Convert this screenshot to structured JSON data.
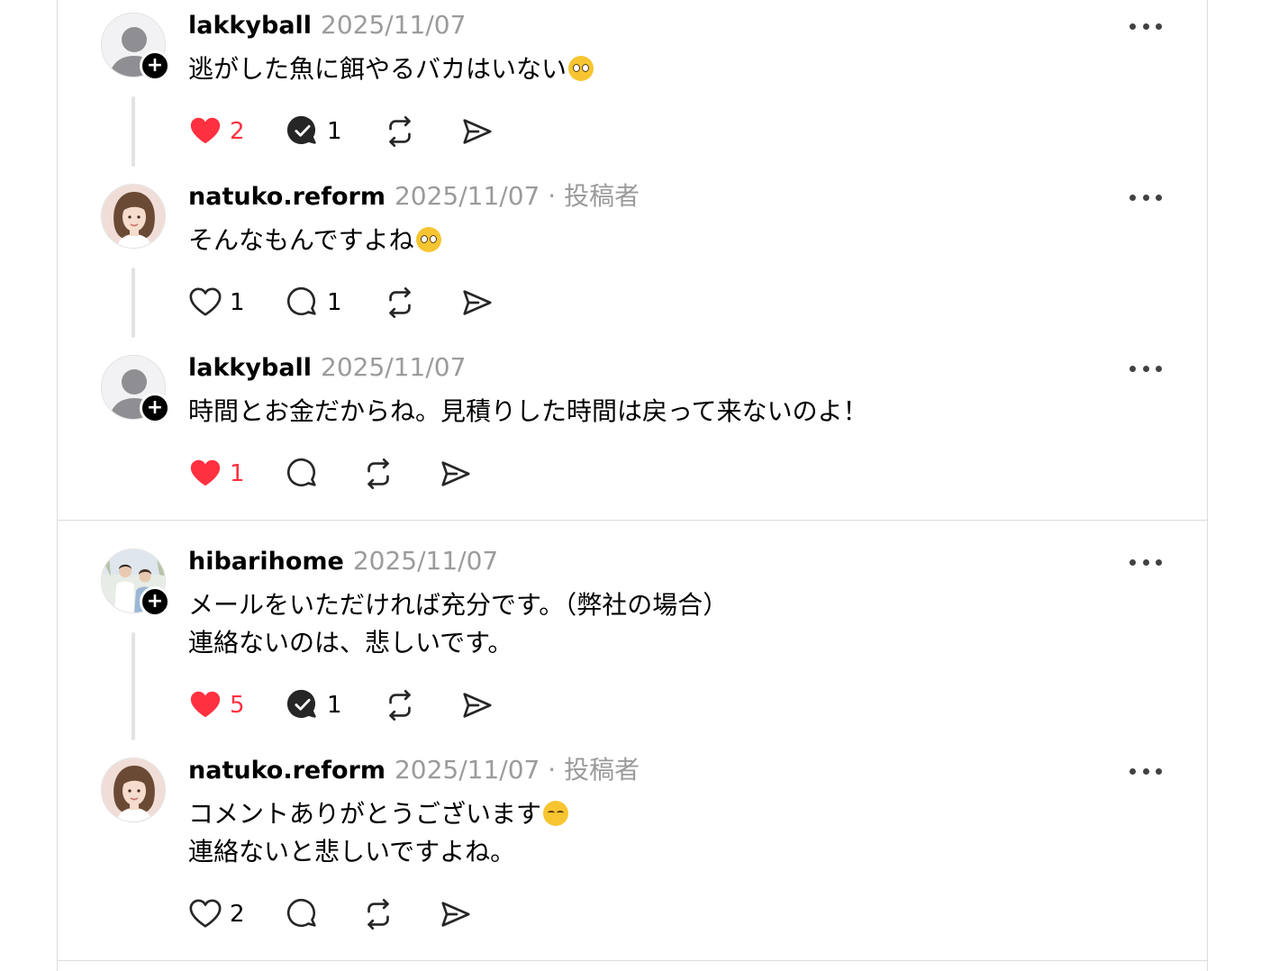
{
  "theme": {
    "like_red": "#ff3040",
    "muted": "#9b9b9b",
    "border": "#dcdcdc"
  },
  "icons": {
    "like": "heart-icon",
    "reply": "comment-bubble-icon",
    "reposted": "check-bubble-icon",
    "repost": "repost-icon",
    "share": "send-icon",
    "more": "more-dots-icon",
    "follow": "plus-icon"
  },
  "follow_label": "+",
  "posts": [
    {
      "username": "lakkyball",
      "date": "2025/11/07",
      "author_tag": "",
      "lines": [
        "逃がした魚に餌やるバカはいない"
      ],
      "like_count": "2",
      "reply_count": "1"
    },
    {
      "username": "natuko.reform",
      "date": "2025/11/07",
      "author_tag": "· 投稿者",
      "lines": [
        "そんなもんですよね"
      ],
      "like_count": "1",
      "reply_count": "1"
    },
    {
      "username": "lakkyball",
      "date": "2025/11/07",
      "author_tag": "",
      "lines": [
        "時間とお金だからね。見積りした時間は戻って来ないのよ！"
      ],
      "like_count": "1",
      "reply_count": ""
    },
    {
      "username": "hibarihome",
      "date": "2025/11/07",
      "author_tag": "",
      "lines": [
        "メールをいただければ充分です。（弊社の場合）",
        "連絡ないのは、悲しいです。"
      ],
      "like_count": "5",
      "reply_count": "1"
    },
    {
      "username": "natuko.reform",
      "date": "2025/11/07",
      "author_tag": "· 投稿者",
      "lines": [
        "コメントありがとうございます",
        "連絡ないと悲しいですよね。"
      ],
      "like_count": "2",
      "reply_count": ""
    }
  ]
}
